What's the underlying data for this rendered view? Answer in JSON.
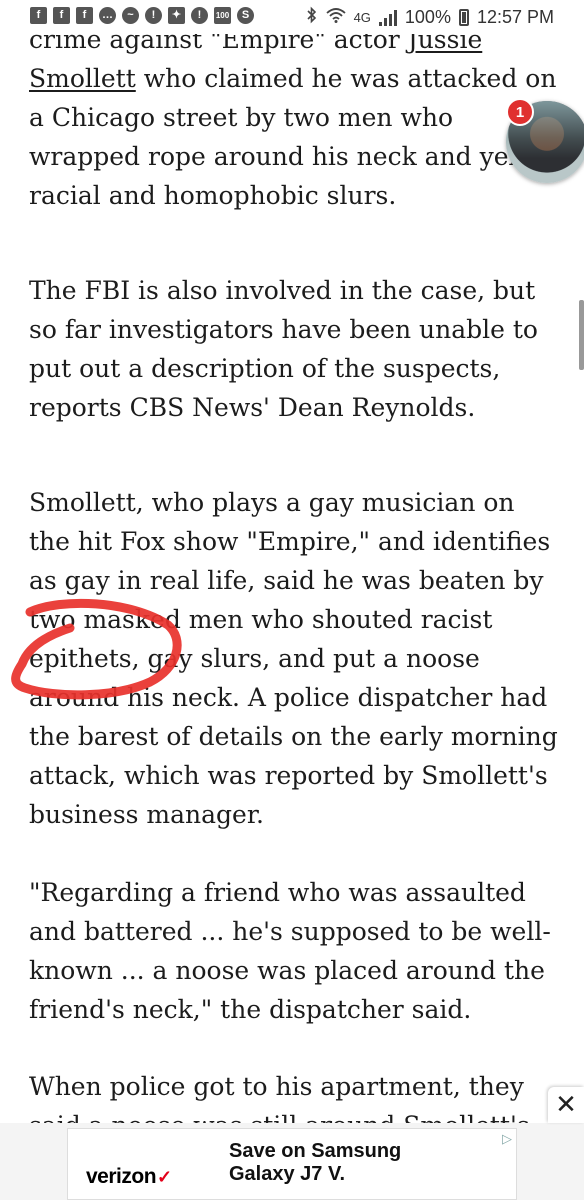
{
  "status_bar": {
    "notification_icons": [
      "flipboard-icon",
      "facebook-icon",
      "facebook-icon",
      "messages-icon",
      "messenger-icon",
      "alert-icon",
      "gear-icon",
      "alert-icon",
      "news100-icon",
      "shazam-icon"
    ],
    "icon_glyphs": [
      "f",
      "f",
      "f",
      "…",
      "~",
      "!",
      "✦",
      "!",
      "100",
      "S"
    ],
    "network": "4G",
    "battery": "100%",
    "time": "12:57 PM"
  },
  "chat_head": {
    "badge_count": "1"
  },
  "article": {
    "p0_line1_prefix": "crime against \"Empire\" actor ",
    "p0_link1": "Jussie",
    "p0_link2": "Smollett",
    "p0_rest": " who claimed he was attacked on a Chicago street by two men who wrapped rope around his neck and yelled racial and homophobic slurs.",
    "p1": "The FBI is also involved in the case, but so far investigators have been unable to put out a description of the suspects, reports CBS News' Dean Reynolds.",
    "p2": "Smollett, who plays a gay musician on the hit Fox show \"Empire,\" and identifies as gay in real life, said he was beaten by two masked men who shouted racist epithets, gay slurs, and put a noose around his neck. A police dispatcher had the barest of details on the early morning attack, which was reported by Smollett's business manager.",
    "p3": "\"Regarding a friend who was assaulted and battered ... he's supposed to be well-known ... a noose was placed around the friend's neck,\" the dispatcher said.",
    "p4": "When police got to his apartment, they said a noose was still around Smollett's"
  },
  "ad": {
    "close_glyph": "✕",
    "brand": "verizon",
    "brand_check": "✓",
    "headline": "Save on Samsung Galaxy J7 V.",
    "adchoices_glyph": "▷"
  },
  "colors": {
    "annotation": "#e8312b",
    "badge": "#e0302f",
    "verizon_check": "#e2001a"
  }
}
